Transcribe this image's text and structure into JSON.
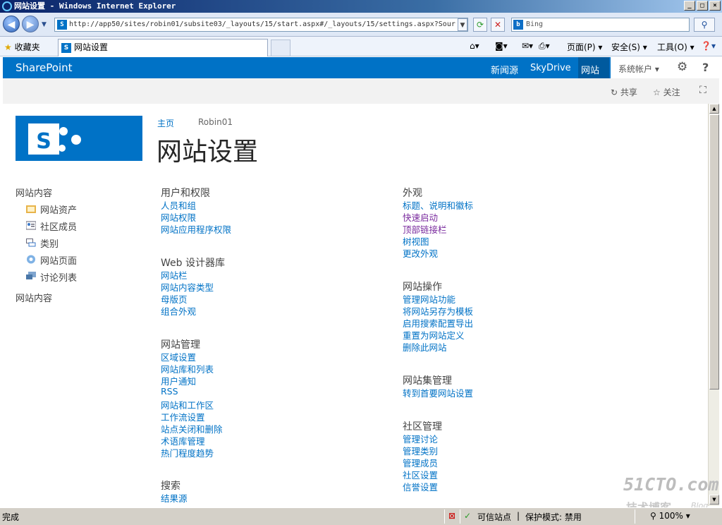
{
  "window": {
    "title": "网站设置 - Windows Internet Explorer",
    "controls": [
      "_",
      "□",
      "×"
    ]
  },
  "browser": {
    "address": "http://app50/sites/robin01/subsite03/_layouts/15/start.aspx#/_layouts/15/settings.aspx?Sour",
    "search_text": "Bing",
    "favorites_label": "收藏夹",
    "tab_title": "网站设置",
    "commands": {
      "page": "页面(P)",
      "safety": "安全(S)",
      "tools": "工具(O)"
    }
  },
  "suite": {
    "brand": "SharePoint",
    "links": [
      "新闻源",
      "SkyDrive",
      "网站"
    ],
    "account": "系统帐户",
    "help": "?"
  },
  "ribbon": {
    "share": "共享",
    "follow": "关注"
  },
  "header": {
    "breadcrumb_home": "主页",
    "breadcrumb_site": "Robin01",
    "page_title": "网站设置"
  },
  "leftnav": {
    "head1": "网站内容",
    "items": [
      "网站资产",
      "社区成员",
      "类别",
      "网站页面",
      "讨论列表"
    ],
    "head2": "网站内容"
  },
  "sections": {
    "users": {
      "title": "用户和权限",
      "links": [
        "人员和组",
        "网站权限",
        "网站应用程序权限"
      ]
    },
    "webdesign": {
      "title": "Web 设计器库",
      "links": [
        "网站栏",
        "网站内容类型",
        "母版页",
        "组合外观"
      ]
    },
    "admin": {
      "title": "网站管理",
      "links": [
        "区域设置",
        "网站库和列表",
        "用户通知",
        "RSS",
        "网站和工作区",
        "工作流设置",
        "站点关闭和删除",
        "术语库管理",
        "热门程度趋势"
      ]
    },
    "search": {
      "title": "搜索",
      "links": [
        "结果源"
      ]
    },
    "look": {
      "title": "外观",
      "links": [
        "标题、说明和徽标",
        "快速启动",
        "顶部链接栏",
        "树视图",
        "更改外观"
      ]
    },
    "actions": {
      "title": "网站操作",
      "links": [
        "管理网站功能",
        "将网站另存为模板",
        "启用搜索配置导出",
        "重置为网站定义",
        "删除此网站"
      ]
    },
    "collection": {
      "title": "网站集管理",
      "links": [
        "转到首要网站设置"
      ]
    },
    "community": {
      "title": "社区管理",
      "links": [
        "管理讨论",
        "管理类别",
        "管理成员",
        "社区设置",
        "信誉设置"
      ]
    }
  },
  "status": {
    "done": "完成",
    "trusted": "可信站点",
    "protected": "保护模式: 禁用",
    "zoom": "100%"
  },
  "watermark": {
    "big": "51CTO.com",
    "small": "技术博客",
    "blog": "Blog"
  },
  "colors": {
    "suite_blue": "#0072c6",
    "link_blue": "#0072c6",
    "visited_purple": "#7a2b9e"
  }
}
